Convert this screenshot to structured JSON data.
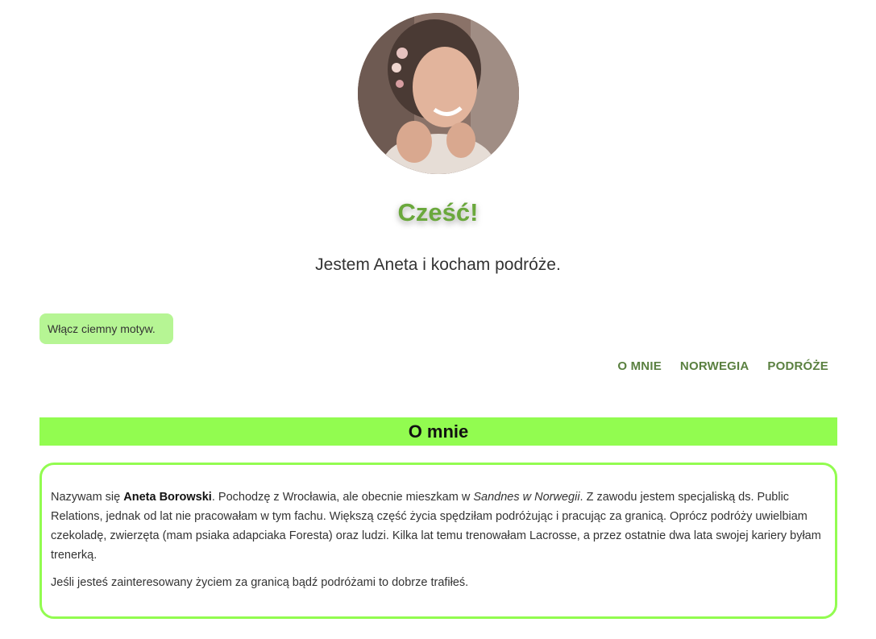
{
  "header": {
    "avatar_alt": "Aneta",
    "greeting": "Cześć!",
    "tagline": "Jestem Aneta i kocham podróże."
  },
  "theme_toggle": {
    "label": "Włącz ciemny motyw."
  },
  "nav": {
    "items": [
      {
        "label": "O MNIE"
      },
      {
        "label": "NORWEGIA"
      },
      {
        "label": "PODRÓŻE"
      }
    ]
  },
  "about": {
    "heading": "O mnie",
    "p1_intro": "Nazywam się ",
    "p1_name": "Aneta Borowski",
    "p1_mid": ". Pochodzę z Wrocławia, ale obecnie mieszkam w ",
    "p1_place": "Sandnes w Norwegii",
    "p1_rest": ". Z zawodu jestem specjaliską ds. Public Relations, jednak od lat nie pracowałam w tym fachu. Większą część życia spędziłam podróżując i pracując za granicą. Oprócz podróży uwielbiam czekoladę, zwierzęta (mam psiaka adapciaka Foresta) oraz ludzi. Kilka lat temu trenowałam Lacrosse, a przez ostatnie dwa lata swojej kariery byłam trenerką.",
    "p2": "Jeśli jesteś zainteresowany życiem za granicą bądź podróżami to dobrze trafiłeś."
  },
  "colors": {
    "accent_green": "#92fc50",
    "button_green": "#b6f594",
    "greeting_green": "#6aa83c",
    "nav_green": "#5a8040"
  }
}
